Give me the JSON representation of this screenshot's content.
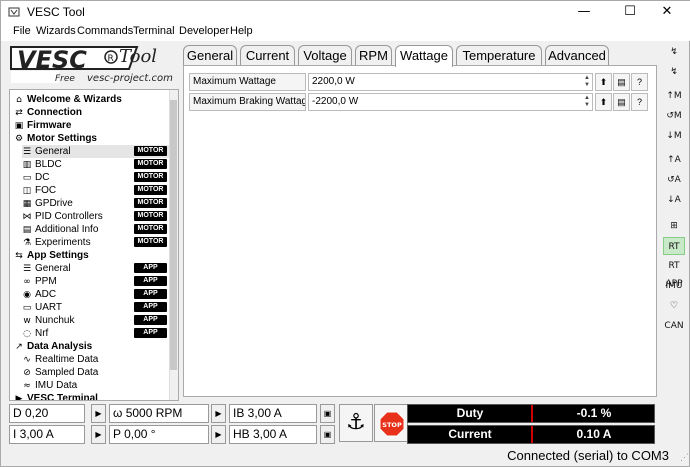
{
  "window": {
    "title": "VESC Tool",
    "minimize": "—",
    "maximize": "☐",
    "close": "✕"
  },
  "menu": [
    "File",
    "Wizards",
    "Commands",
    "Terminal",
    "Developer",
    "Help"
  ],
  "logo": {
    "brand": "VESC",
    "suffix": "Tool",
    "tag": "Free",
    "url": "vesc-project.com"
  },
  "tabs": [
    "General",
    "Current",
    "Voltage",
    "RPM",
    "Wattage",
    "Temperature",
    "Advanced"
  ],
  "active_tab": "Wattage",
  "params": [
    {
      "label": "Maximum Wattage",
      "value": "2200,0 W"
    },
    {
      "label": "Maximum Braking Wattage",
      "value": "-2200,0 W"
    }
  ],
  "tree": [
    {
      "label": "Welcome & Wizards",
      "icon": "home-icon",
      "bold": true,
      "badge": ""
    },
    {
      "label": "Connection",
      "icon": "connection-icon",
      "bold": true,
      "badge": ""
    },
    {
      "label": "Firmware",
      "icon": "chip-icon",
      "bold": true,
      "badge": ""
    },
    {
      "label": "Motor Settings",
      "icon": "motor-icon",
      "bold": true,
      "badge": ""
    },
    {
      "label": "General",
      "icon": "sliders-icon",
      "bold": false,
      "badge": "MOTOR"
    },
    {
      "label": "BLDC",
      "icon": "bldc-icon",
      "bold": false,
      "badge": "MOTOR"
    },
    {
      "label": "DC",
      "icon": "dc-icon",
      "bold": false,
      "badge": "MOTOR"
    },
    {
      "label": "FOC",
      "icon": "foc-icon",
      "bold": false,
      "badge": "MOTOR"
    },
    {
      "label": "GPDrive",
      "icon": "gpdrive-icon",
      "bold": false,
      "badge": "MOTOR"
    },
    {
      "label": "PID Controllers",
      "icon": "pid-icon",
      "bold": false,
      "badge": "MOTOR"
    },
    {
      "label": "Additional Info",
      "icon": "info-icon",
      "bold": false,
      "badge": "MOTOR"
    },
    {
      "label": "Experiments",
      "icon": "flask-icon",
      "bold": false,
      "badge": "MOTOR"
    },
    {
      "label": "App Settings",
      "icon": "app-icon",
      "bold": true,
      "badge": ""
    },
    {
      "label": "General",
      "icon": "sliders-icon",
      "bold": false,
      "badge": "APP"
    },
    {
      "label": "PPM",
      "icon": "ppm-icon",
      "bold": false,
      "badge": "APP"
    },
    {
      "label": "ADC",
      "icon": "adc-icon",
      "bold": false,
      "badge": "APP"
    },
    {
      "label": "UART",
      "icon": "uart-icon",
      "bold": false,
      "badge": "APP"
    },
    {
      "label": "Nunchuk",
      "icon": "nunchuk-icon",
      "bold": false,
      "badge": "APP"
    },
    {
      "label": "Nrf",
      "icon": "nrf-icon",
      "bold": false,
      "badge": "APP"
    },
    {
      "label": "Data Analysis",
      "icon": "chart-icon",
      "bold": true,
      "badge": ""
    },
    {
      "label": "Realtime Data",
      "icon": "realtime-icon",
      "bold": false,
      "badge": ""
    },
    {
      "label": "Sampled Data",
      "icon": "sampled-icon",
      "bold": false,
      "badge": ""
    },
    {
      "label": "IMU Data",
      "icon": "imu-icon",
      "bold": false,
      "badge": ""
    },
    {
      "label": "VESC Terminal",
      "icon": "terminal-icon",
      "bold": true,
      "badge": ""
    }
  ],
  "right_toolbar": [
    "↯",
    "↯",
    "↑M",
    "↺M",
    "↓M",
    "↑A",
    "↺A",
    "↓A",
    "⊞",
    "RT",
    "RT APP",
    "IMU",
    "♡",
    "CAN"
  ],
  "bottom": {
    "duty": "D 0,20",
    "rpm": "ω 5000 RPM",
    "ib": "IB 3,00 A",
    "current": "I 3,00 A",
    "pos": "P 0,00 °",
    "hb": "HB 3,00 A",
    "stop": "STOP"
  },
  "gauges": [
    {
      "label": "Duty",
      "value": "-0.1 %"
    },
    {
      "label": "Current",
      "value": "0.10 A"
    }
  ],
  "status": "Connected (serial) to COM3",
  "colors": {
    "badge": "#000000",
    "gauge_bg": "#000000",
    "stop": "#e8311a",
    "active_toolbar": "#c8eac8"
  }
}
